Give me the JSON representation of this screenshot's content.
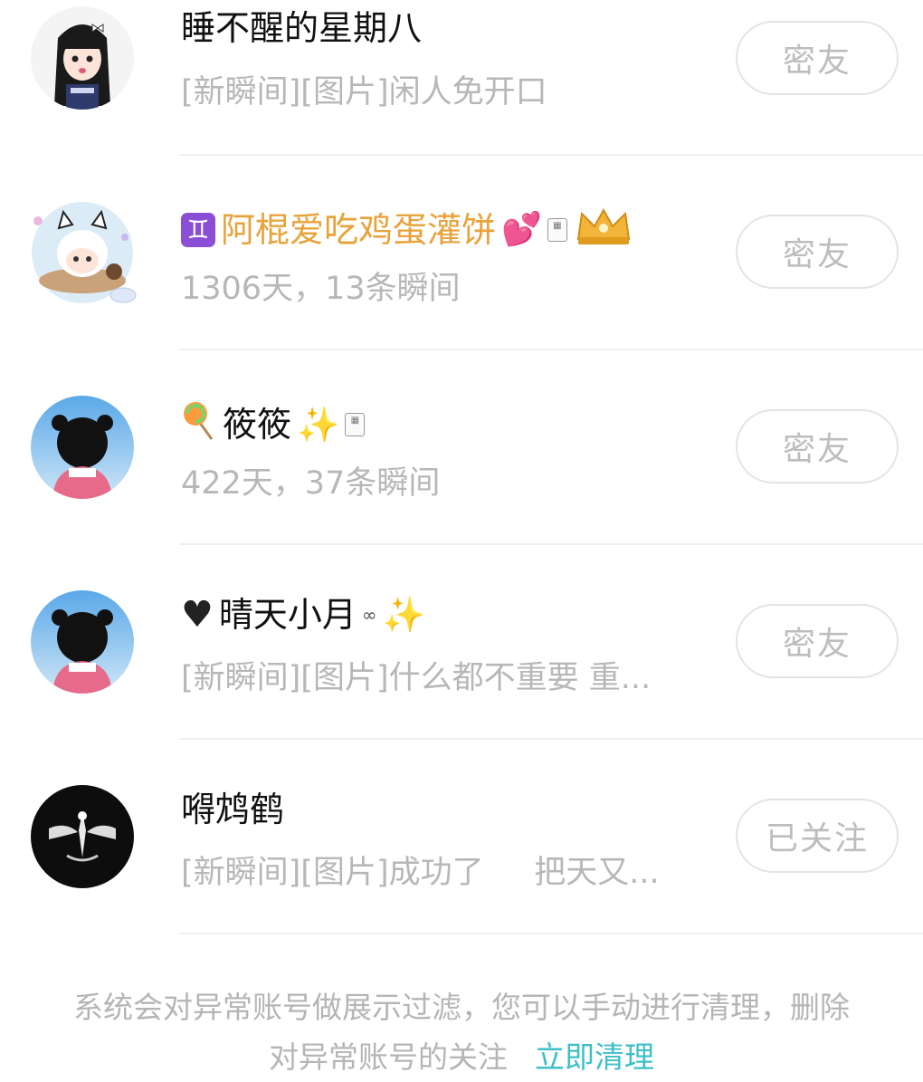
{
  "friends": [
    {
      "name": "睡不醒的星期八",
      "subtitle": "[新瞬间][图片]闲人免开口",
      "button": "密友",
      "avatar_icon": "girl-avatar"
    },
    {
      "name_prefix_icon": "gemini-icon",
      "name": "阿棍爱吃鸡蛋灌饼",
      "name_suffix_icons": [
        "hearts-icon",
        "tile-icon",
        "crown-icon"
      ],
      "subtitle": "1306天，13条瞬间",
      "button": "密友",
      "avatar_icon": "cat-girl-avatar",
      "name_color": "#e8a23a"
    },
    {
      "name_prefix_icon": "lollipop-icon",
      "name": "筱筱",
      "name_suffix_icons": [
        "sparkles-icon",
        "tile-icon"
      ],
      "subtitle": "422天，37条瞬间",
      "button": "密友",
      "avatar_icon": "girl-back-avatar"
    },
    {
      "name_prefix_icon": "black-heart-icon",
      "name": "晴天小月",
      "name_suffix_icons": [
        "bow-icon",
        "sparkles-icon"
      ],
      "subtitle": "[新瞬间][图片]什么都不重要 重...",
      "button": "密友",
      "avatar_icon": "girl-back-avatar"
    },
    {
      "name": "嘚鸩鹤",
      "subtitle": "[新瞬间][图片]成功了     把天又...",
      "button": "已关注",
      "avatar_icon": "dark-crest-avatar"
    }
  ],
  "footer": {
    "line1": "系统会对异常账号做展示过滤，您可以手动进行清理，删除",
    "line2": "对异常账号的关注",
    "link": "立即清理"
  },
  "colors": {
    "accent_link": "#3dbfc8",
    "gold_name": "#e8a23a",
    "subtitle_gray": "#b7b7b7"
  }
}
